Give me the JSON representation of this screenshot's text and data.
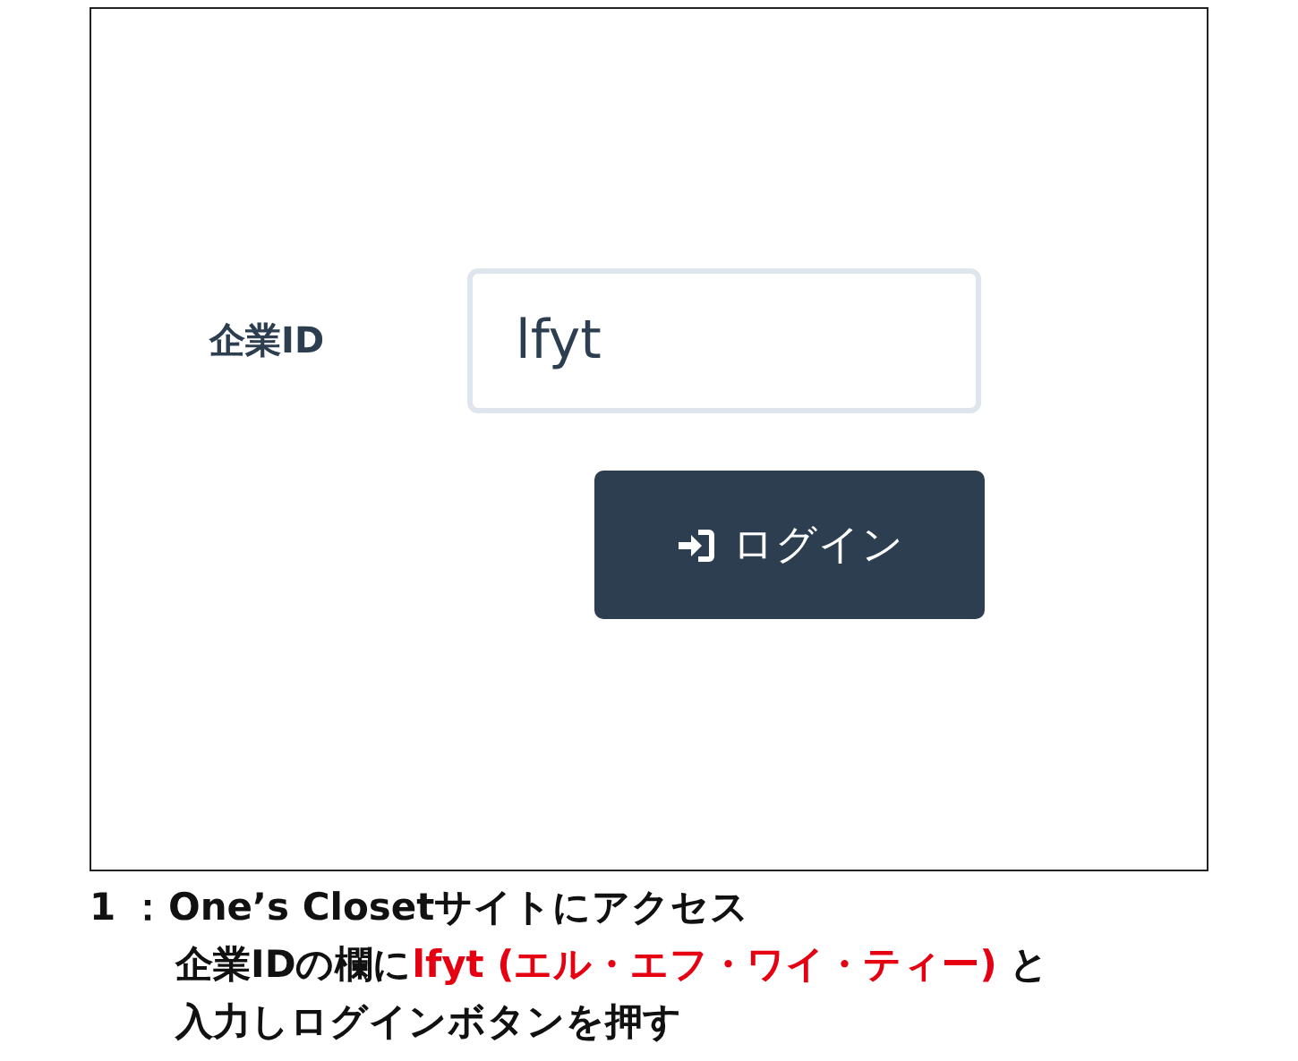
{
  "login_form": {
    "field": {
      "label": "企業ID",
      "value": "lfyt"
    },
    "login_button": {
      "label": "ログイン"
    }
  },
  "caption": {
    "step": "1",
    "separator": "：",
    "title": "One’s Closetサイトにアクセス",
    "instruction_lines": [
      [
        {
          "text": "企業IDの欄に",
          "highlight": false
        },
        {
          "text": "lfyt (エル・エフ・ワイ・ティー)",
          "highlight": true
        },
        {
          "text": " と",
          "highlight": false
        }
      ],
      [
        {
          "text": "入力しログインボタンを押す",
          "highlight": false
        }
      ]
    ]
  }
}
